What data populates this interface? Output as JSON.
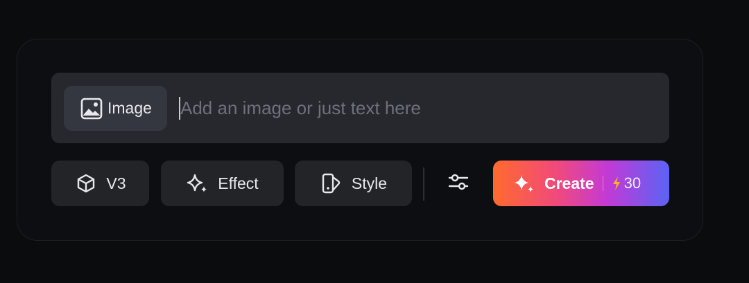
{
  "prompt": {
    "image_chip_label": "Image",
    "input_value": "",
    "input_placeholder": "Add an image or just text here"
  },
  "toolbar": {
    "model_label": "V3",
    "effect_label": "Effect",
    "style_label": "Style",
    "create_label": "Create",
    "credits": "30"
  },
  "icons": {
    "image_chip": "image-icon",
    "model": "cube-icon",
    "effect": "sparkles-icon",
    "style": "style-icon",
    "settings": "sliders-icon",
    "create": "sparkles-icon",
    "credits": "lightning-icon"
  },
  "colors": {
    "background": "#0b0c0e",
    "prompt_bar": "#26282d",
    "pill": "#222428",
    "create_gradient_start": "#ff6a2e",
    "create_gradient_end": "#5b63f5",
    "credits_bolt": "#ffb21e"
  }
}
